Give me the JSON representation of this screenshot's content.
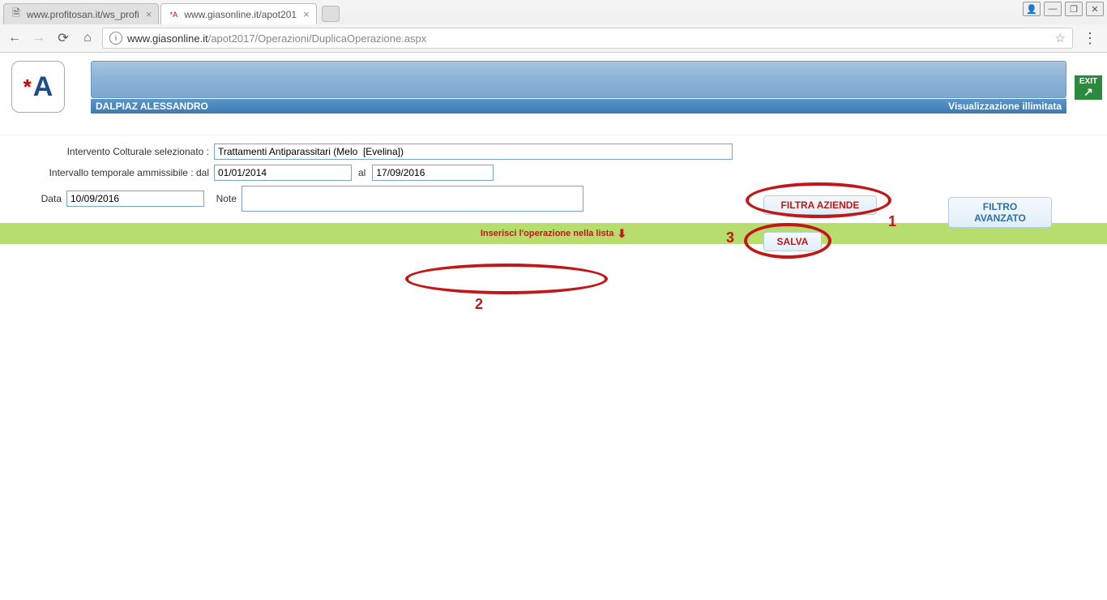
{
  "tabs": [
    {
      "title": "www.profitosan.it/ws_profi",
      "active": false
    },
    {
      "title": "www.giasonline.it/apot201",
      "active": true
    }
  ],
  "url": {
    "domain": "www.giasonline.it",
    "path": "/apot2017/Operazioni/DuplicaOperazione.aspx"
  },
  "exit": {
    "label": "EXIT"
  },
  "userbar": {
    "left": "DALPIAZ ALESSANDRO",
    "right": "Visualizzazione illimitata"
  },
  "form": {
    "intervento_label": "Intervento Colturale selezionato :",
    "intervento_value": "Trattamenti Antiparassitari (Melo  [Evelina])",
    "intervallo_label": "Intervallo temporale ammissibile : dal",
    "dal_value": "01/01/2014",
    "al_label": "al",
    "al_value": "17/09/2016",
    "data_label": "Data",
    "data_value": "10/09/2016",
    "note_label": "Note",
    "note_value": ""
  },
  "buttons": {
    "filtra": "FILTRA AZIENDE",
    "filtro_avanzato": "FILTRO AVANZATO",
    "salva": "SALVA"
  },
  "greenbar": {
    "text": "Inserisci l'operazione nella lista"
  },
  "annotations": {
    "a1": "1",
    "a2": "2",
    "a3": "3"
  }
}
